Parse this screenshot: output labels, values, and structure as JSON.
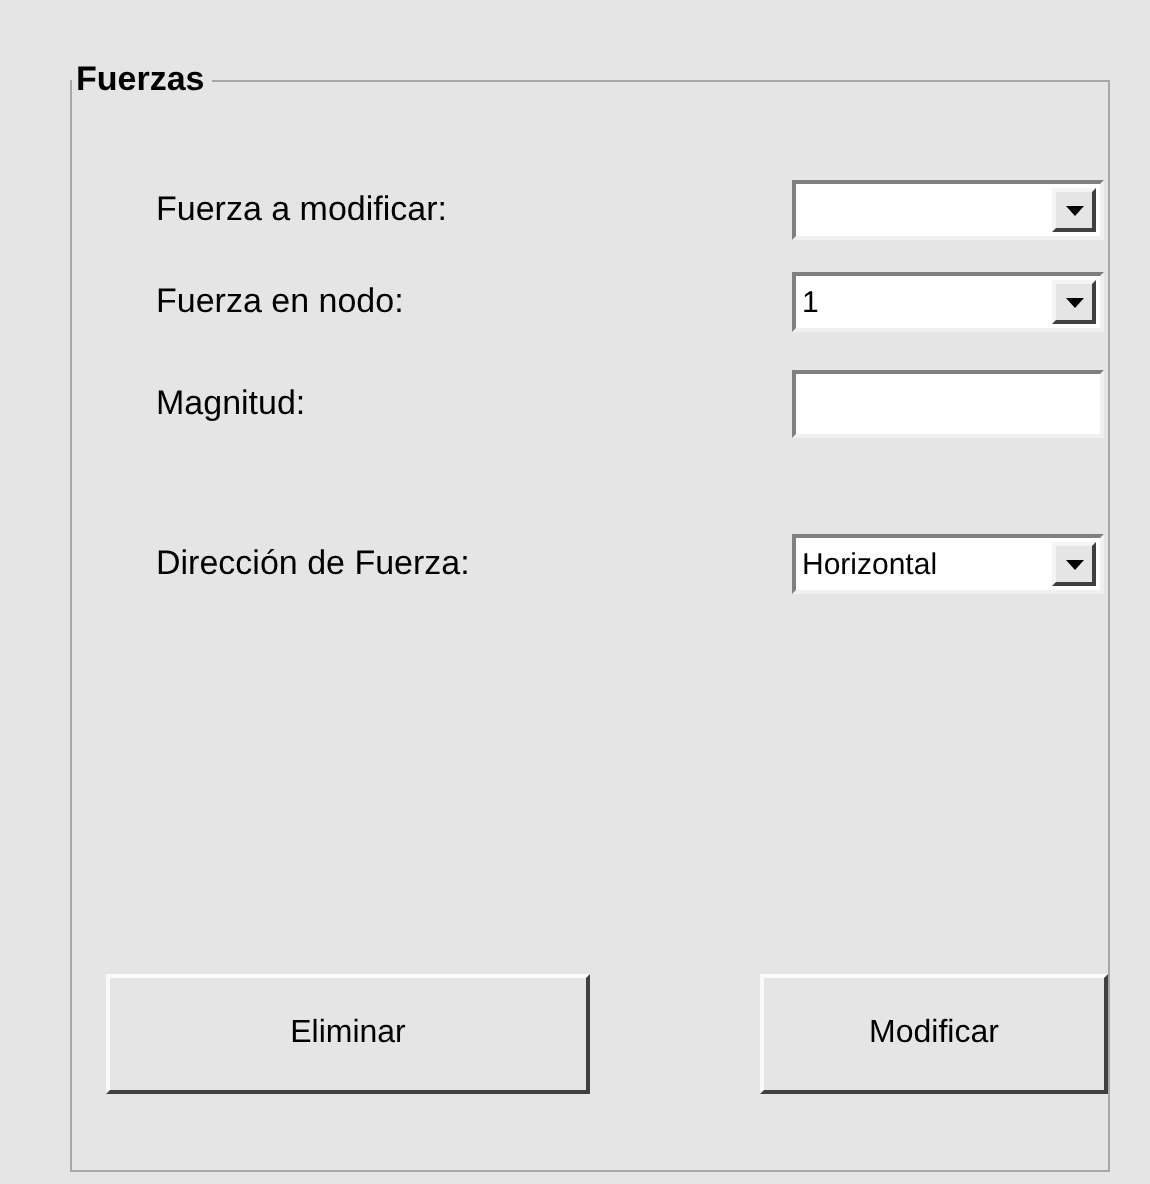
{
  "group": {
    "title": "Fuerzas"
  },
  "fields": [
    {
      "kind": "dropdown",
      "label": "Fuerza a modificar:"
    },
    {
      "kind": "dropdown",
      "label": "Fuerza en nodo:",
      "value": "1"
    },
    {
      "kind": "textbox",
      "label": "Magnitud:"
    },
    {
      "kind": "dropdown",
      "label": "Dirección de Fuerza:",
      "value": "Horizontal"
    }
  ],
  "buttons": [
    "Eliminar",
    "Modificar"
  ]
}
